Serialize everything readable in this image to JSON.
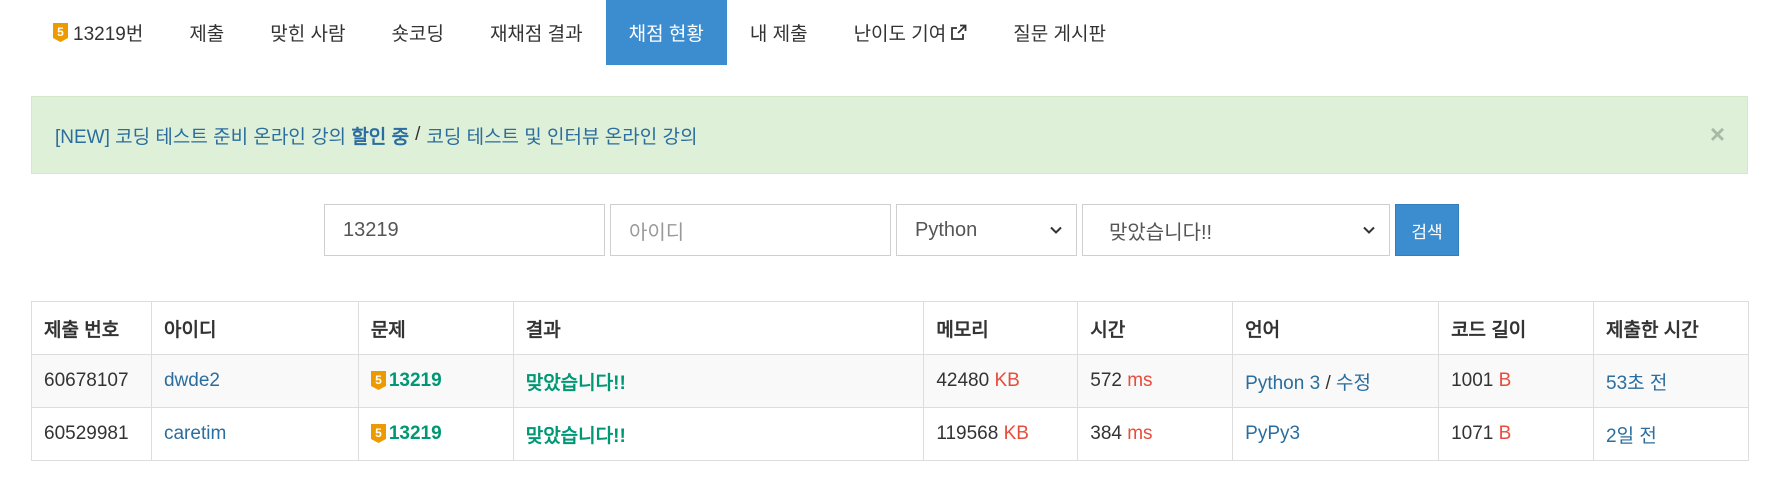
{
  "nav": {
    "problem_tab": {
      "tier": "5",
      "label": "13219번"
    },
    "tabs": [
      {
        "label": "제출"
      },
      {
        "label": "맞힌 사람"
      },
      {
        "label": "숏코딩"
      },
      {
        "label": "재채점 결과"
      },
      {
        "label": "채점 현황"
      },
      {
        "label": "내 제출"
      },
      {
        "label": "난이도 기여"
      },
      {
        "label": "질문 게시판"
      }
    ],
    "active_tab": "채점 현황"
  },
  "alert": {
    "prefix": "[NEW] 코딩 테스트 준비 온라인 강의",
    "highlight": "할인 중",
    "separator": "/",
    "link2": "코딩 테스트 및 인터뷰 온라인 강의",
    "close": "×"
  },
  "search": {
    "problem_id": "13219",
    "user_placeholder": "아이디",
    "language": "Python",
    "result": "맞았습니다!!",
    "button": "검색"
  },
  "table": {
    "headers": [
      "제출 번호",
      "아이디",
      "문제",
      "결과",
      "메모리",
      "시간",
      "언어",
      "코드 길이",
      "제출한 시간"
    ],
    "rows": [
      {
        "id": "60678107",
        "user": "dwde2",
        "tier": "5",
        "problem": "13219",
        "result": "맞았습니다!!",
        "memory": "42480",
        "memory_unit": "KB",
        "time": "572",
        "time_unit": "ms",
        "language": "Python 3",
        "lang_sep": "/",
        "edit": "수정",
        "code_len": "1001",
        "code_unit": "B",
        "submitted": "53초 전"
      },
      {
        "id": "60529981",
        "user": "caretim",
        "tier": "5",
        "problem": "13219",
        "result": "맞았습니다!!",
        "memory": "119568",
        "memory_unit": "KB",
        "time": "384",
        "time_unit": "ms",
        "language": "PyPy3",
        "lang_sep": "",
        "edit": "",
        "code_len": "1071",
        "code_unit": "B",
        "submitted": "2일 전"
      }
    ]
  },
  "colors": {
    "accent": "#3c8dd0",
    "alert_bg": "#dff0d8",
    "success": "#009874",
    "unit": "#e74c3c",
    "link": "#2a6d9e",
    "tier_gold": "#ec9a00"
  }
}
